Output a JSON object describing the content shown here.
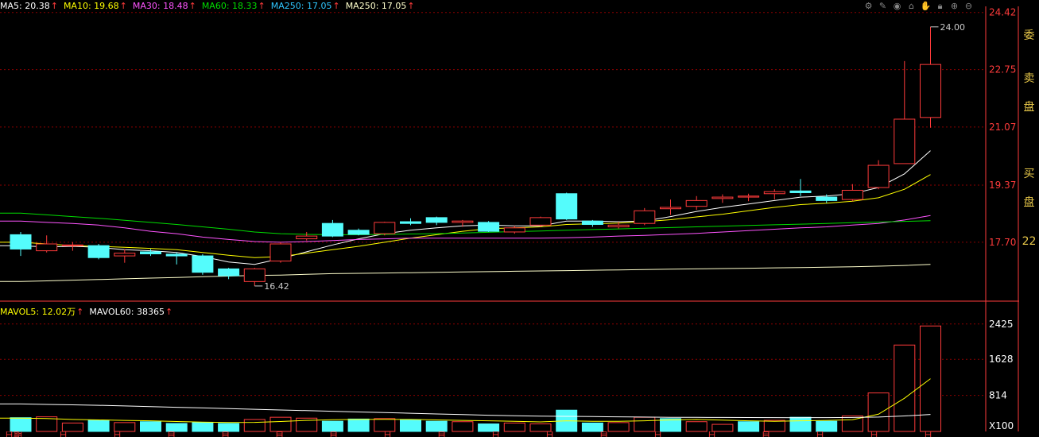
{
  "price_legend": [
    {
      "label": "MA5",
      "value": "20.38",
      "color": "#ffffff"
    },
    {
      "label": "MA10",
      "value": "19.68",
      "color": "#ffff00"
    },
    {
      "label": "MA30",
      "value": "18.48",
      "color": "#ff55ff"
    },
    {
      "label": "MA60",
      "value": "18.33",
      "color": "#00dd00"
    },
    {
      "label": "MA250",
      "value": "17.05",
      "color": "#2fc6ff"
    },
    {
      "label": "MA250",
      "value": "17.05",
      "color": "#ffffcc"
    }
  ],
  "volume_legend": [
    {
      "label": "MAVOL5",
      "value": "12.02万",
      "color": "#ffff00"
    },
    {
      "label": "MAVOL60",
      "value": "38365",
      "color": "#ffffff"
    }
  ],
  "toolbar_icons": [
    "gear-icon",
    "pen-icon",
    "eye-icon",
    "basket-icon",
    "hand-icon",
    "lock-icon",
    "zoom-in-icon",
    "zoom-out-icon"
  ],
  "price_axis": {
    "labels": [
      "24.42",
      "22.75",
      "21.07",
      "19.37",
      "17.70"
    ]
  },
  "volume_axis": {
    "labels": [
      "2425",
      "1628",
      "814"
    ],
    "unit": "X100"
  },
  "annotations": {
    "high": "24.00",
    "low": "16.42"
  },
  "side_panel": {
    "chars": [
      "委",
      "卖",
      "盘",
      "买",
      "盘",
      "22"
    ]
  },
  "colors": {
    "up": "#ff3b3b",
    "down": "#54fcfc",
    "grid": "#8b0000",
    "axis": "#ff3b3b"
  },
  "chart_data": [
    {
      "type": "candlestick",
      "ylim": [
        16.0,
        24.6
      ],
      "candles": [
        {
          "o": 17.92,
          "c": 17.5,
          "h": 18.0,
          "l": 17.3,
          "dir": "down"
        },
        {
          "o": 17.45,
          "c": 17.65,
          "h": 17.9,
          "l": 17.4,
          "dir": "up"
        },
        {
          "o": 17.6,
          "c": 17.62,
          "h": 17.7,
          "l": 17.45,
          "dir": "up"
        },
        {
          "o": 17.6,
          "c": 17.25,
          "h": 17.65,
          "l": 17.2,
          "dir": "down"
        },
        {
          "o": 17.3,
          "c": 17.38,
          "h": 17.5,
          "l": 17.1,
          "dir": "up"
        },
        {
          "o": 17.42,
          "c": 17.36,
          "h": 17.5,
          "l": 17.3,
          "dir": "down"
        },
        {
          "o": 17.35,
          "c": 17.3,
          "h": 17.4,
          "l": 17.05,
          "dir": "down"
        },
        {
          "o": 17.3,
          "c": 16.82,
          "h": 17.35,
          "l": 16.75,
          "dir": "down"
        },
        {
          "o": 16.92,
          "c": 16.72,
          "h": 16.95,
          "l": 16.62,
          "dir": "down"
        },
        {
          "o": 16.55,
          "c": 16.92,
          "h": 16.95,
          "l": 16.42,
          "dir": "up"
        },
        {
          "o": 17.15,
          "c": 17.65,
          "h": 17.7,
          "l": 17.1,
          "dir": "up"
        },
        {
          "o": 17.8,
          "c": 17.88,
          "h": 18.0,
          "l": 17.75,
          "dir": "up"
        },
        {
          "o": 18.25,
          "c": 17.88,
          "h": 18.35,
          "l": 17.85,
          "dir": "down"
        },
        {
          "o": 18.05,
          "c": 17.93,
          "h": 18.1,
          "l": 17.9,
          "dir": "down"
        },
        {
          "o": 17.95,
          "c": 18.28,
          "h": 18.3,
          "l": 17.9,
          "dir": "up"
        },
        {
          "o": 18.3,
          "c": 18.25,
          "h": 18.4,
          "l": 18.2,
          "dir": "down"
        },
        {
          "o": 18.42,
          "c": 18.28,
          "h": 18.45,
          "l": 18.2,
          "dir": "down"
        },
        {
          "o": 18.28,
          "c": 18.32,
          "h": 18.35,
          "l": 18.15,
          "dir": "up"
        },
        {
          "o": 18.28,
          "c": 18.02,
          "h": 18.32,
          "l": 18.0,
          "dir": "down"
        },
        {
          "o": 18.0,
          "c": 18.12,
          "h": 18.18,
          "l": 17.95,
          "dir": "up"
        },
        {
          "o": 18.2,
          "c": 18.42,
          "h": 18.45,
          "l": 18.15,
          "dir": "up"
        },
        {
          "o": 19.12,
          "c": 18.38,
          "h": 19.15,
          "l": 18.35,
          "dir": "down"
        },
        {
          "o": 18.32,
          "c": 18.22,
          "h": 18.35,
          "l": 18.15,
          "dir": "down"
        },
        {
          "o": 18.15,
          "c": 18.2,
          "h": 18.3,
          "l": 18.1,
          "dir": "up"
        },
        {
          "o": 18.25,
          "c": 18.62,
          "h": 18.7,
          "l": 18.2,
          "dir": "up"
        },
        {
          "o": 18.68,
          "c": 18.72,
          "h": 18.95,
          "l": 18.5,
          "dir": "up"
        },
        {
          "o": 18.75,
          "c": 18.92,
          "h": 19.05,
          "l": 18.65,
          "dir": "up"
        },
        {
          "o": 18.98,
          "c": 19.02,
          "h": 19.1,
          "l": 18.85,
          "dir": "up"
        },
        {
          "o": 19.02,
          "c": 19.05,
          "h": 19.12,
          "l": 18.9,
          "dir": "up"
        },
        {
          "o": 19.12,
          "c": 19.18,
          "h": 19.25,
          "l": 18.95,
          "dir": "up"
        },
        {
          "o": 19.2,
          "c": 19.15,
          "h": 19.55,
          "l": 19.05,
          "dir": "down"
        },
        {
          "o": 19.02,
          "c": 18.92,
          "h": 19.1,
          "l": 18.85,
          "dir": "down"
        },
        {
          "o": 18.95,
          "c": 19.22,
          "h": 19.4,
          "l": 18.9,
          "dir": "up"
        },
        {
          "o": 19.3,
          "c": 19.95,
          "h": 20.1,
          "l": 19.25,
          "dir": "up"
        },
        {
          "o": 20.0,
          "c": 21.3,
          "h": 23.0,
          "l": 20.0,
          "dir": "up"
        },
        {
          "o": 21.35,
          "c": 22.9,
          "h": 24.0,
          "l": 21.05,
          "dir": "up"
        }
      ],
      "ma_series": [
        {
          "name": "MA5",
          "color": "#ffffff",
          "start": 0,
          "values": [
            17.6,
            17.56,
            17.58,
            17.55,
            17.48,
            17.45,
            17.4,
            17.28,
            17.12,
            17.05,
            17.22,
            17.42,
            17.62,
            17.8,
            17.95,
            18.05,
            18.12,
            18.18,
            18.2,
            18.18,
            18.18,
            18.32,
            18.32,
            18.3,
            18.32,
            18.45,
            18.6,
            18.72,
            18.82,
            18.92,
            19.02,
            19.05,
            19.12,
            19.3,
            19.7,
            20.38
          ]
        },
        {
          "name": "MA10",
          "color": "#ffff00",
          "start": 0,
          "values": [
            17.7,
            17.65,
            17.6,
            17.58,
            17.55,
            17.52,
            17.48,
            17.4,
            17.32,
            17.25,
            17.28,
            17.38,
            17.48,
            17.58,
            17.7,
            17.82,
            17.92,
            18.02,
            18.1,
            18.12,
            18.15,
            18.22,
            18.24,
            18.26,
            18.3,
            18.36,
            18.44,
            18.52,
            18.62,
            18.72,
            18.8,
            18.84,
            18.9,
            19.0,
            19.25,
            19.68
          ]
        },
        {
          "name": "MA30",
          "color": "#ff55ff",
          "start": 0,
          "values": [
            18.32,
            18.28,
            18.25,
            18.2,
            18.12,
            18.02,
            17.95,
            17.85,
            17.78,
            17.72,
            17.7,
            17.72,
            17.75,
            17.78,
            17.8,
            17.82,
            17.82,
            17.82,
            17.82,
            17.82,
            17.82,
            17.83,
            17.85,
            17.88,
            17.9,
            17.93,
            17.96,
            18.0,
            18.04,
            18.08,
            18.12,
            18.15,
            18.2,
            18.25,
            18.35,
            18.48
          ]
        },
        {
          "name": "MA60",
          "color": "#00dd00",
          "start": 0,
          "values": [
            18.55,
            18.5,
            18.45,
            18.4,
            18.34,
            18.28,
            18.22,
            18.15,
            18.08,
            18.0,
            17.95,
            17.93,
            17.92,
            17.92,
            17.93,
            17.94,
            17.95,
            17.97,
            17.99,
            18.01,
            18.03,
            18.05,
            18.07,
            18.09,
            18.11,
            18.13,
            18.15,
            18.17,
            18.19,
            18.21,
            18.23,
            18.25,
            18.27,
            18.29,
            18.31,
            18.33
          ]
        },
        {
          "name": "MA250",
          "color": "#ffffcc",
          "start": 0,
          "values": [
            16.55,
            16.57,
            16.59,
            16.61,
            16.63,
            16.65,
            16.67,
            16.69,
            16.71,
            16.73,
            16.74,
            16.76,
            16.78,
            16.79,
            16.8,
            16.81,
            16.82,
            16.83,
            16.84,
            16.85,
            16.86,
            16.87,
            16.88,
            16.89,
            16.9,
            16.91,
            16.92,
            16.93,
            16.94,
            16.95,
            16.96,
            16.97,
            16.98,
            17.0,
            17.02,
            17.05
          ]
        }
      ]
    },
    {
      "type": "bar",
      "ylim": [
        0,
        2600
      ],
      "volumes": [
        {
          "v": 310,
          "dir": "down"
        },
        {
          "v": 330,
          "dir": "up"
        },
        {
          "v": 190,
          "dir": "up"
        },
        {
          "v": 250,
          "dir": "down"
        },
        {
          "v": 200,
          "dir": "up"
        },
        {
          "v": 220,
          "dir": "down"
        },
        {
          "v": 180,
          "dir": "down"
        },
        {
          "v": 200,
          "dir": "down"
        },
        {
          "v": 180,
          "dir": "down"
        },
        {
          "v": 270,
          "dir": "up"
        },
        {
          "v": 320,
          "dir": "up"
        },
        {
          "v": 300,
          "dir": "up"
        },
        {
          "v": 230,
          "dir": "down"
        },
        {
          "v": 280,
          "dir": "down"
        },
        {
          "v": 290,
          "dir": "up"
        },
        {
          "v": 260,
          "dir": "down"
        },
        {
          "v": 230,
          "dir": "down"
        },
        {
          "v": 220,
          "dir": "up"
        },
        {
          "v": 170,
          "dir": "down"
        },
        {
          "v": 190,
          "dir": "up"
        },
        {
          "v": 170,
          "dir": "up"
        },
        {
          "v": 480,
          "dir": "down"
        },
        {
          "v": 190,
          "dir": "down"
        },
        {
          "v": 200,
          "dir": "up"
        },
        {
          "v": 320,
          "dir": "up"
        },
        {
          "v": 290,
          "dir": "down"
        },
        {
          "v": 220,
          "dir": "up"
        },
        {
          "v": 160,
          "dir": "up"
        },
        {
          "v": 220,
          "dir": "down"
        },
        {
          "v": 250,
          "dir": "up"
        },
        {
          "v": 320,
          "dir": "down"
        },
        {
          "v": 230,
          "dir": "down"
        },
        {
          "v": 350,
          "dir": "up"
        },
        {
          "v": 870,
          "dir": "up"
        },
        {
          "v": 1950,
          "dir": "up"
        },
        {
          "v": 2380,
          "dir": "up"
        }
      ],
      "mavol5": [
        300,
        290,
        270,
        260,
        250,
        240,
        225,
        210,
        200,
        205,
        225,
        250,
        265,
        270,
        275,
        270,
        260,
        250,
        240,
        230,
        215,
        240,
        230,
        230,
        240,
        260,
        270,
        255,
        240,
        230,
        240,
        250,
        265,
        390,
        750,
        1190
      ],
      "mavol60": [
        620,
        610,
        600,
        590,
        575,
        560,
        545,
        530,
        515,
        500,
        485,
        470,
        455,
        440,
        425,
        410,
        395,
        380,
        365,
        355,
        345,
        340,
        335,
        330,
        325,
        320,
        318,
        316,
        314,
        312,
        310,
        312,
        315,
        325,
        350,
        384
      ]
    }
  ],
  "bottom_tabs": [
    "日期",
    "日",
    "日",
    "自",
    "自",
    "自",
    "自",
    "日",
    "自",
    "日",
    "日",
    "自",
    "日",
    "日",
    "自",
    "日",
    "日",
    "日"
  ]
}
